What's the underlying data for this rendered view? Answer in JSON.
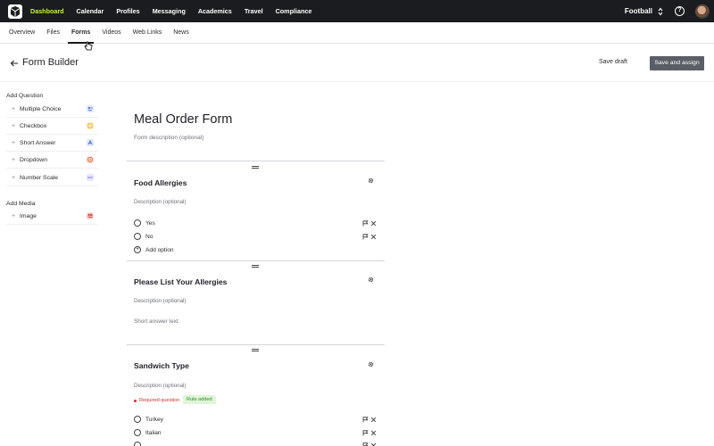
{
  "topnav": {
    "items": [
      "Dashboard",
      "Calendar",
      "Profiles",
      "Messaging",
      "Academics",
      "Travel",
      "Compliance"
    ],
    "active_index": 0,
    "team": "Football",
    "help": "?"
  },
  "subnav": {
    "items": [
      "Overview",
      "Files",
      "Forms",
      "Videos",
      "Web Links",
      "News"
    ],
    "active_index": 2
  },
  "header": {
    "title": "Form Builder",
    "save_draft": "Save draft",
    "save_assign": "Save and assign"
  },
  "sidebar": {
    "add_question_label": "Add Question",
    "questions": [
      {
        "label": "Multiple Choice",
        "icon": "multiple-choice-icon",
        "color": "#5b7be8"
      },
      {
        "label": "Checkbox",
        "icon": "checkbox-icon",
        "color": "#f2b21f"
      },
      {
        "label": "Short Answer",
        "icon": "short-answer-icon",
        "color": "#4f6ee0"
      },
      {
        "label": "Dropdown",
        "icon": "dropdown-icon",
        "color": "#e9582f"
      },
      {
        "label": "Number Scale",
        "icon": "number-scale-icon",
        "color": "#6d63d9"
      }
    ],
    "add_media_label": "Add Media",
    "media": [
      {
        "label": "Image",
        "icon": "image-icon",
        "color": "#e04a4a"
      }
    ]
  },
  "form": {
    "title": "Meal Order Form",
    "description_placeholder": "Form description (optional)",
    "questions": [
      {
        "title": "Food Allergies",
        "description": "Description (optional)",
        "options": [
          "Yes",
          "No"
        ],
        "add_option": "Add option"
      },
      {
        "title": "Please List Your Allergies",
        "description": "Description (optional)",
        "answer_placeholder": "Short answer text"
      },
      {
        "title": "Sandwich Type",
        "description": "Description (optional)",
        "required_text": "Required question",
        "rule_badge": "Rule added",
        "options": [
          "Turkey",
          "Italian"
        ]
      }
    ]
  },
  "colors": {
    "topnav_bg": "#1b1c1f",
    "active_nav": "#c6f432",
    "primary_button": "#5a5e66",
    "required": "#d22e2e",
    "rule_badge_bg": "#dff6d9"
  }
}
